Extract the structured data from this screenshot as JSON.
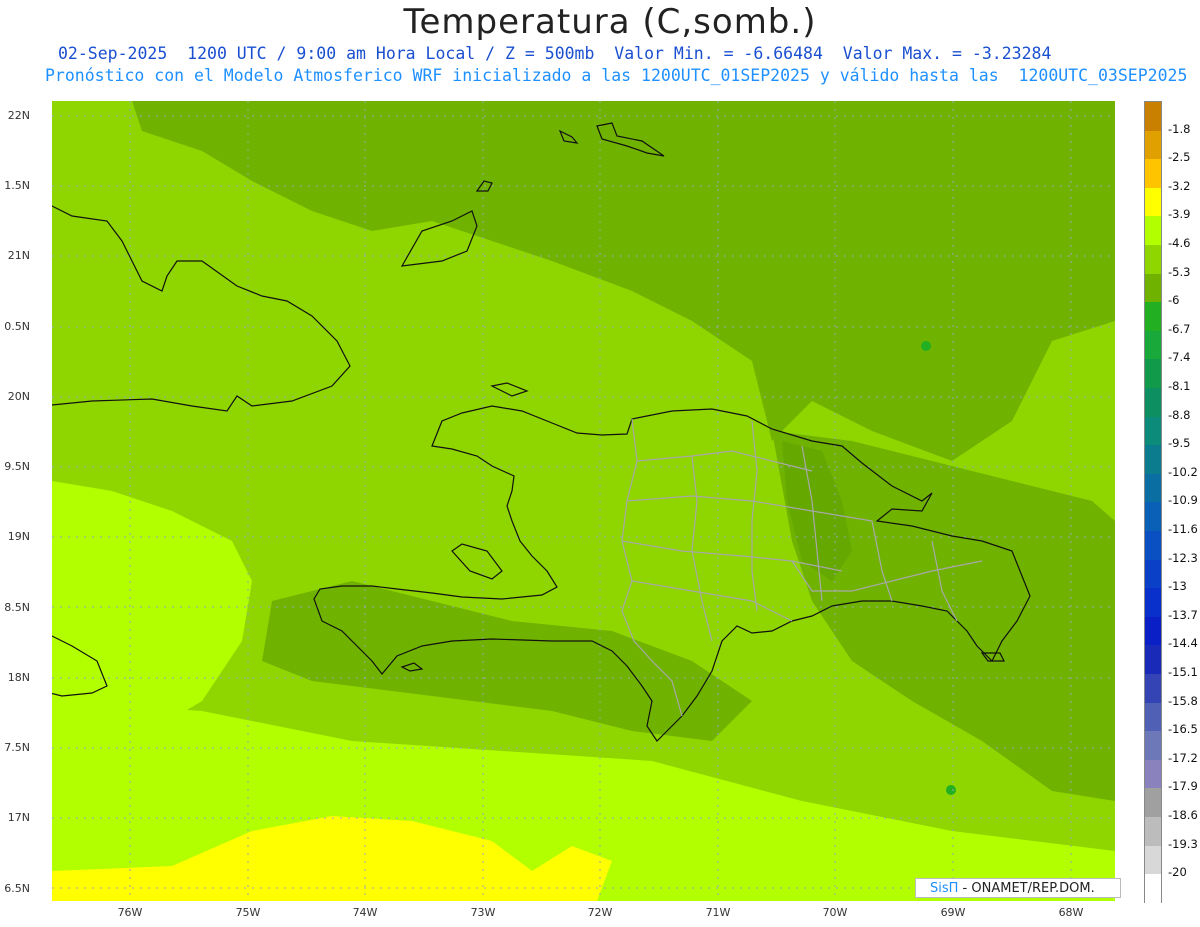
{
  "header": {
    "title": "Temperatura (C,somb.)",
    "subtitle": "02-Sep-2025  1200 UTC / 9:00 am Hora Local / Z = 500mb  Valor Min. = -6.66484  Valor Max. = -3.23284",
    "forecast": "Pronóstico con el Modelo Atmosferico WRF inicializado a las 1200UTC_01SEP2025 y válido hasta las  1200UTC_03SEP2025"
  },
  "axes": {
    "lat_labels": [
      "22N",
      "1.5N",
      "21N",
      "0.5N",
      "20N",
      "9.5N",
      "19N",
      "8.5N",
      "18N",
      "7.5N",
      "17N",
      "6.5N"
    ],
    "lon_labels": [
      "76W",
      "75W",
      "74W",
      "73W",
      "72W",
      "71W",
      "70W",
      "69W",
      "68W"
    ]
  },
  "colorbar": {
    "labels": [
      "-1.8",
      "-2.5",
      "-3.2",
      "-3.9",
      "-4.6",
      "-5.3",
      "-6",
      "-6.7",
      "-7.4",
      "-8.1",
      "-8.8",
      "-9.5",
      "-10.2",
      "-10.9",
      "-11.6",
      "-12.3",
      "-13",
      "-13.7",
      "-14.4",
      "-15.1",
      "-15.8",
      "-16.5",
      "-17.2",
      "-17.9",
      "-18.6",
      "-19.3",
      "-20"
    ],
    "colors": [
      "#c98000",
      "#e0a000",
      "#ffc400",
      "#ffff00",
      "#b2ff00",
      "#8fd600",
      "#6fb300",
      "#22b022",
      "#19a83a",
      "#109a4a",
      "#0d8f62",
      "#0c8a7a",
      "#0b7c8e",
      "#0b6ea2",
      "#0a60b6",
      "#0a50c2",
      "#0a40c8",
      "#0a30cc",
      "#0a20c6",
      "#1a2ab8",
      "#3444b4",
      "#5060b4",
      "#6c78b8",
      "#8a82bc",
      "#a0a0a0",
      "#bcbcbc",
      "#d8d8d8"
    ],
    "bottom_color": "#ffffff"
  },
  "credit": {
    "brand": "SisΠ",
    "text": " - ONAMET/REP.DOM."
  }
}
